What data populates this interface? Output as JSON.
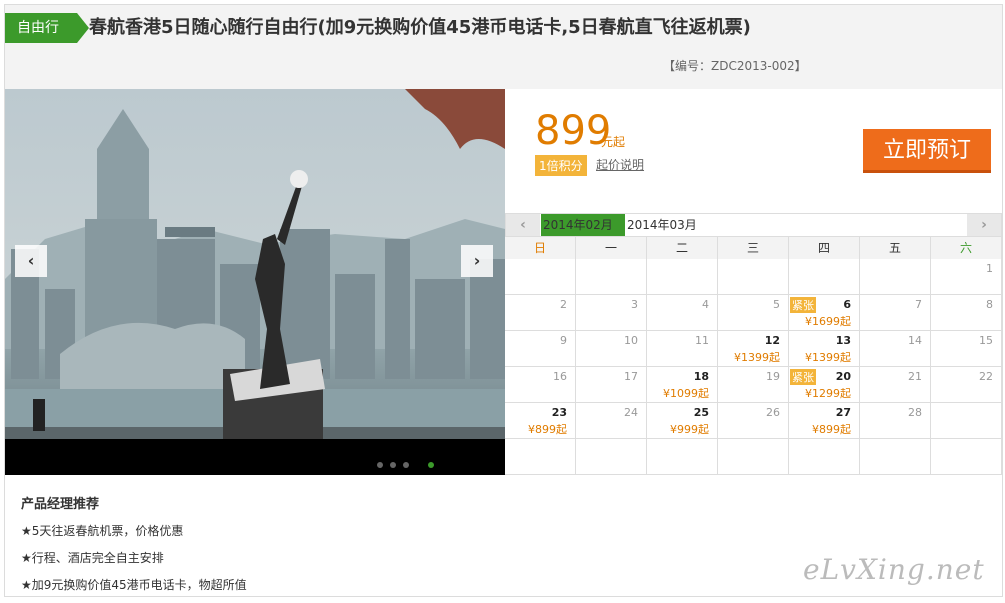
{
  "header": {
    "tag": "自由行",
    "title": "春航香港5日随心随行自由行(加9元换购价值45港币电话卡,5日春航直飞往返机票)",
    "code": "【编号：ZDC2013-002】"
  },
  "gallery": {
    "prev_icon": "chevron-left-icon",
    "next_icon": "chevron-right-icon",
    "slide_count": 4,
    "active_slide": 4
  },
  "pricing": {
    "price": "899",
    "unit": "元起",
    "points": "1倍积分",
    "note": "起价说明",
    "book_label": "立即预订"
  },
  "calendar": {
    "current_month": "2014年02月",
    "next_month": "2014年03月",
    "weekdays": [
      "日",
      "一",
      "二",
      "三",
      "四",
      "五",
      "六"
    ],
    "weekday_colors": [
      "#e07c00",
      "#333333",
      "#333333",
      "#333333",
      "#333333",
      "#333333",
      "#3c9a2b"
    ],
    "rows": [
      [
        {
          "d": ""
        },
        {
          "d": ""
        },
        {
          "d": ""
        },
        {
          "d": ""
        },
        {
          "d": ""
        },
        {
          "d": ""
        },
        {
          "d": "1"
        }
      ],
      [
        {
          "d": "2"
        },
        {
          "d": "3"
        },
        {
          "d": "4"
        },
        {
          "d": "5"
        },
        {
          "d": "6",
          "p": "¥1699起",
          "b": "紧张"
        },
        {
          "d": "7"
        },
        {
          "d": "8"
        }
      ],
      [
        {
          "d": "9"
        },
        {
          "d": "10"
        },
        {
          "d": "11"
        },
        {
          "d": "12",
          "p": "¥1399起"
        },
        {
          "d": "13",
          "p": "¥1399起"
        },
        {
          "d": "14"
        },
        {
          "d": "15"
        }
      ],
      [
        {
          "d": "16"
        },
        {
          "d": "17"
        },
        {
          "d": "18",
          "p": "¥1099起"
        },
        {
          "d": "19"
        },
        {
          "d": "20",
          "p": "¥1299起",
          "b": "紧张"
        },
        {
          "d": "21"
        },
        {
          "d": "22"
        }
      ],
      [
        {
          "d": "23",
          "p": "¥899起"
        },
        {
          "d": "24"
        },
        {
          "d": "25",
          "p": "¥999起"
        },
        {
          "d": "26"
        },
        {
          "d": "27",
          "p": "¥899起"
        },
        {
          "d": "28"
        },
        {
          "d": ""
        }
      ],
      [
        {
          "d": ""
        },
        {
          "d": ""
        },
        {
          "d": ""
        },
        {
          "d": ""
        },
        {
          "d": ""
        },
        {
          "d": ""
        },
        {
          "d": ""
        }
      ]
    ]
  },
  "recommend": {
    "heading": "产品经理推荐",
    "items": [
      "★5天往返春航机票，价格优惠",
      "★行程、酒店完全自主安排",
      "★加9元换购价值45港币电话卡，物超所值"
    ]
  },
  "watermark": "eLvXing.net",
  "colors": {
    "brand_green": "#3c9a2b",
    "price_orange": "#e07c00",
    "button_orange": "#ee6c1b"
  }
}
